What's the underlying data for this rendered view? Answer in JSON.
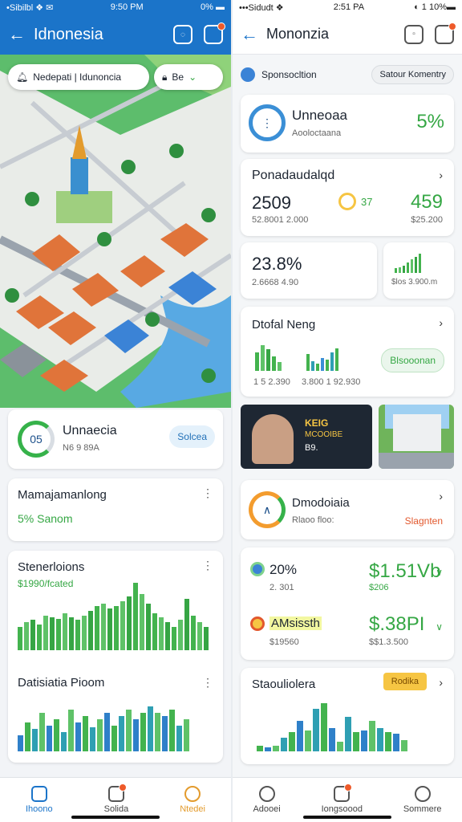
{
  "left": {
    "status": {
      "left": "•Sibilbl ❖ ✉",
      "time": "9:50 PM",
      "right": "0% ▬"
    },
    "appbar": {
      "title": "Idnonesia"
    },
    "search": {
      "location": "Nedepati | Idunoncia",
      "filter": "Be"
    },
    "card_ring": {
      "ring_value": "05",
      "title": "Unnaecia",
      "subtitle": "N6 9 89A",
      "button": "Solcea"
    },
    "card_manage": {
      "title": "Mamajamanlong",
      "metric": "5% Sanom"
    },
    "card_stats": {
      "title": "Stenerloions",
      "subtitle": "$1990/fcated"
    },
    "card_data": {
      "title": "Datisiatia Pioom"
    },
    "nav": {
      "home": "Ihoono",
      "solida": "Solida",
      "right": "Ntedei"
    },
    "stats_chart": {
      "type": "bar",
      "values": [
        20,
        24,
        26,
        22,
        30,
        28,
        27,
        32,
        28,
        26,
        30,
        34,
        38,
        40,
        36,
        38,
        42,
        46,
        58,
        48,
        40,
        32,
        28,
        24,
        20,
        26,
        44,
        30,
        24,
        20
      ]
    },
    "data_chart": {
      "type": "bar",
      "values": [
        10,
        18,
        14,
        24,
        16,
        20,
        12,
        26,
        18,
        22,
        15,
        20,
        24,
        16,
        22,
        26,
        20,
        24,
        28,
        24,
        22,
        26,
        16,
        20
      ]
    }
  },
  "right": {
    "status": {
      "left": "•••Sidudt ❖",
      "time": "2:51 PA",
      "right": "◐ 1 10%▬"
    },
    "appbar": {
      "title": "Mononzia"
    },
    "top_row": {
      "label": "Sponsocltion",
      "button": "Satour Komentry"
    },
    "card1": {
      "title": "Unneoaa",
      "subtitle": "Aooloctaana",
      "value": "5%"
    },
    "card2": {
      "title": "Ponadaudalqd",
      "value": "2509",
      "value_sub": "52.8001 2.000",
      "mid": "37",
      "right_value": "459",
      "right_sub": "$25.200"
    },
    "card3": {
      "value": "23.8%",
      "sub": "2.6668 4.90",
      "right_sub": "$los 3.900.m"
    },
    "card4": {
      "title": "Dtofal Neng",
      "sub1": "1 5 2.390",
      "sub2": "3.800 1 92.930",
      "button": "Blsooonan"
    },
    "media": {
      "headline": "KEIG",
      "line2": "MCOOIBE",
      "line3": "B9."
    },
    "card5": {
      "title": "Dmodoiaia",
      "subtitle": "Rlaoo floo:",
      "action": "Slagnten"
    },
    "card6": {
      "rows": [
        {
          "label": "20%",
          "sub": "2. 301",
          "value": "$1.51Vb",
          "value_sub": "$206"
        },
        {
          "label": "AMsissth",
          "sub": "$19560",
          "value": "$.38PI",
          "value_sub": "$$1.3.500"
        }
      ]
    },
    "card7": {
      "title": "Staouliolera",
      "badge": "Rodika"
    },
    "nav": {
      "left": "Adooei",
      "mid": "Iongsoood",
      "right": "Sommere"
    },
    "bars_a": {
      "type": "bar",
      "values": [
        20,
        28,
        24,
        16,
        10
      ]
    },
    "bars_b": {
      "type": "bar",
      "values": [
        18,
        10,
        8,
        14,
        12,
        20,
        24
      ]
    },
    "bars_c": {
      "type": "bar",
      "values": [
        6,
        8,
        10,
        14,
        18,
        22,
        26
      ]
    },
    "bars_d": {
      "type": "bar",
      "values": [
        6,
        4,
        6,
        14,
        20,
        32,
        22,
        44,
        50,
        24,
        10,
        36,
        20,
        22,
        32,
        24,
        20,
        18,
        12
      ]
    }
  },
  "colors": {
    "primary": "#1b74c9",
    "green": "#35a744",
    "orange": "#e2582d",
    "yellow": "#f6c543"
  }
}
